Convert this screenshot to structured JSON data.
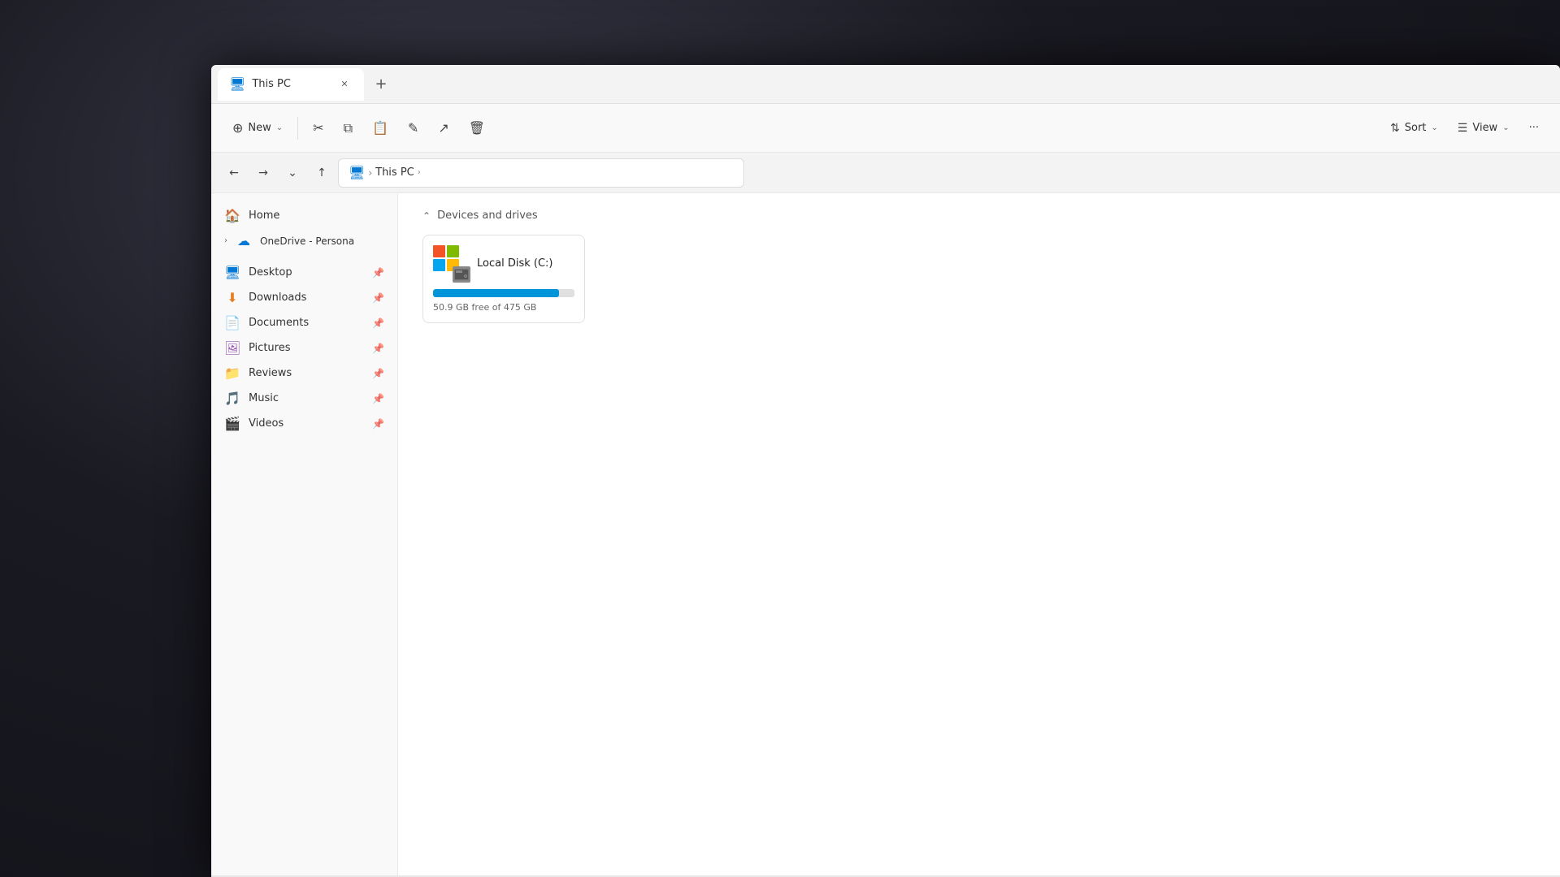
{
  "window": {
    "title": "This PC",
    "tab_label": "This PC",
    "new_tab_symbol": "+"
  },
  "toolbar": {
    "new_label": "New",
    "new_chevron": "⌄",
    "cut_label": "",
    "copy_label": "",
    "paste_label": "",
    "rename_label": "",
    "share_label": "",
    "delete_label": "",
    "sort_label": "Sort",
    "sort_chevron": "⌄",
    "view_label": "View",
    "view_chevron": "⌄",
    "more_label": "···"
  },
  "nav": {
    "back_symbol": "←",
    "forward_symbol": "→",
    "dropdown_symbol": "⌄",
    "up_symbol": "↑",
    "breadcrumb": [
      {
        "icon": "🖥",
        "label": "This PC"
      }
    ],
    "breadcrumb_separator": "›",
    "breadcrumb_end": "›"
  },
  "sidebar": {
    "home_label": "Home",
    "onedrive_label": "OneDrive - Persona",
    "onedrive_chevron": "›",
    "quick_access": [
      {
        "id": "desktop",
        "label": "Desktop",
        "icon": "🖥",
        "color": "icon-desktop",
        "pinned": true
      },
      {
        "id": "downloads",
        "label": "Downloads",
        "icon": "⬇",
        "color": "icon-downloads",
        "pinned": true
      },
      {
        "id": "documents",
        "label": "Documents",
        "icon": "📄",
        "color": "icon-documents",
        "pinned": true
      },
      {
        "id": "pictures",
        "label": "Pictures",
        "icon": "🖼",
        "color": "icon-pictures",
        "pinned": true
      },
      {
        "id": "reviews",
        "label": "Reviews",
        "icon": "📁",
        "color": "icon-reviews",
        "pinned": true
      },
      {
        "id": "music",
        "label": "Music",
        "icon": "🎵",
        "color": "icon-music",
        "pinned": true
      },
      {
        "id": "videos",
        "label": "Videos",
        "icon": "🎬",
        "color": "icon-videos",
        "pinned": true
      }
    ]
  },
  "content": {
    "section_label": "Devices and drives",
    "section_chevron": "⌃",
    "drives": [
      {
        "id": "c-drive",
        "name": "Local Disk (C:)",
        "free_gb": 50.9,
        "total_gb": 475,
        "free_label": "50.9 GB free of 475 GB",
        "used_percent": 89,
        "bar_color": "#0095d9"
      }
    ]
  },
  "colors": {
    "accent": "#0078d4",
    "progress_bar": "#0095d9",
    "progress_bg": "#e0e0e0"
  }
}
